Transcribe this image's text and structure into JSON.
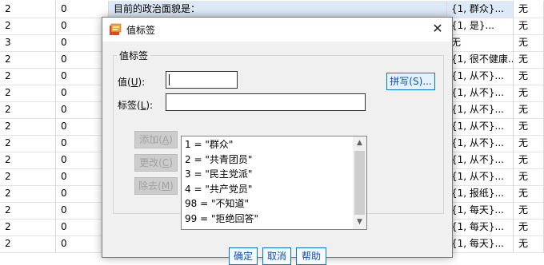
{
  "background_rows": [
    {
      "c1": "2",
      "c2": "0",
      "c3": "目前的政治面貌是：",
      "c4": "{1, 群众}...",
      "c5": "无",
      "hl": true
    },
    {
      "c1": "2",
      "c2": "0",
      "c3": "",
      "c4": "{1, 是}...",
      "c5": "无",
      "hl": false
    },
    {
      "c1": "3",
      "c2": "0",
      "c3": "",
      "c4": "无",
      "c5": "无",
      "hl": false
    },
    {
      "c1": "2",
      "c2": "0",
      "c3": "",
      "c4": "{1, 很不健康...",
      "c5": "无",
      "hl": false
    },
    {
      "c1": "2",
      "c2": "0",
      "c3": "",
      "c4": "{1, 从不}...",
      "c5": "无",
      "hl": false
    },
    {
      "c1": "2",
      "c2": "0",
      "c3": "",
      "c4": "{1, 从不}...",
      "c5": "无",
      "hl": false
    },
    {
      "c1": "2",
      "c2": "0",
      "c3": "",
      "c4": "{1, 从不}...",
      "c5": "无",
      "hl": false
    },
    {
      "c1": "2",
      "c2": "0",
      "c3": "",
      "c4": "{1, 从不}...",
      "c5": "无",
      "hl": false
    },
    {
      "c1": "2",
      "c2": "0",
      "c3": "",
      "c4": "{1, 从不}...",
      "c5": "无",
      "hl": false
    },
    {
      "c1": "2",
      "c2": "0",
      "c3": "",
      "c4": "{1, 从不}...",
      "c5": "无",
      "hl": false
    },
    {
      "c1": "2",
      "c2": "0",
      "c3": "",
      "c4": "{1, 从不}...",
      "c5": "无",
      "hl": false
    },
    {
      "c1": "2",
      "c2": "0",
      "c3": "",
      "c4": "{1, 报纸}...",
      "c5": "无",
      "hl": false
    },
    {
      "c1": "2",
      "c2": "0",
      "c3": "",
      "c4": "{1, 每天}...",
      "c5": "无",
      "hl": false
    },
    {
      "c1": "2",
      "c2": "0",
      "c3": "",
      "c4": "{1, 每天}...",
      "c5": "无",
      "hl": false
    },
    {
      "c1": "2",
      "c2": "0",
      "c3": "",
      "c4": "{1, 每天}...",
      "c5": "无",
      "hl": false
    }
  ],
  "dialog": {
    "title": "值标签",
    "group_title": "值标签",
    "value_label": "值(",
    "value_mn": "U",
    "value_suffix": "):",
    "label_label": "标签(",
    "label_mn": "L",
    "label_suffix": "):",
    "value_input": "",
    "label_input": "",
    "spelling_button": "拼写(S)...",
    "add_button": "添加(",
    "add_mn": "A",
    "change_button": "更改(",
    "change_mn": "C",
    "remove_button": "除去(",
    "remove_mn": "M",
    "list_items": [
      "1 = \"群众\"",
      "2 = \"共青团员\"",
      "3 = \"民主党派\"",
      "4 = \"共产党员\"",
      "98 = \"不知道\"",
      "99 = \"拒绝回答\""
    ],
    "ok_button": "确定",
    "cancel_button": "取消",
    "help_button": "帮助",
    "close_symbol": "✕"
  }
}
